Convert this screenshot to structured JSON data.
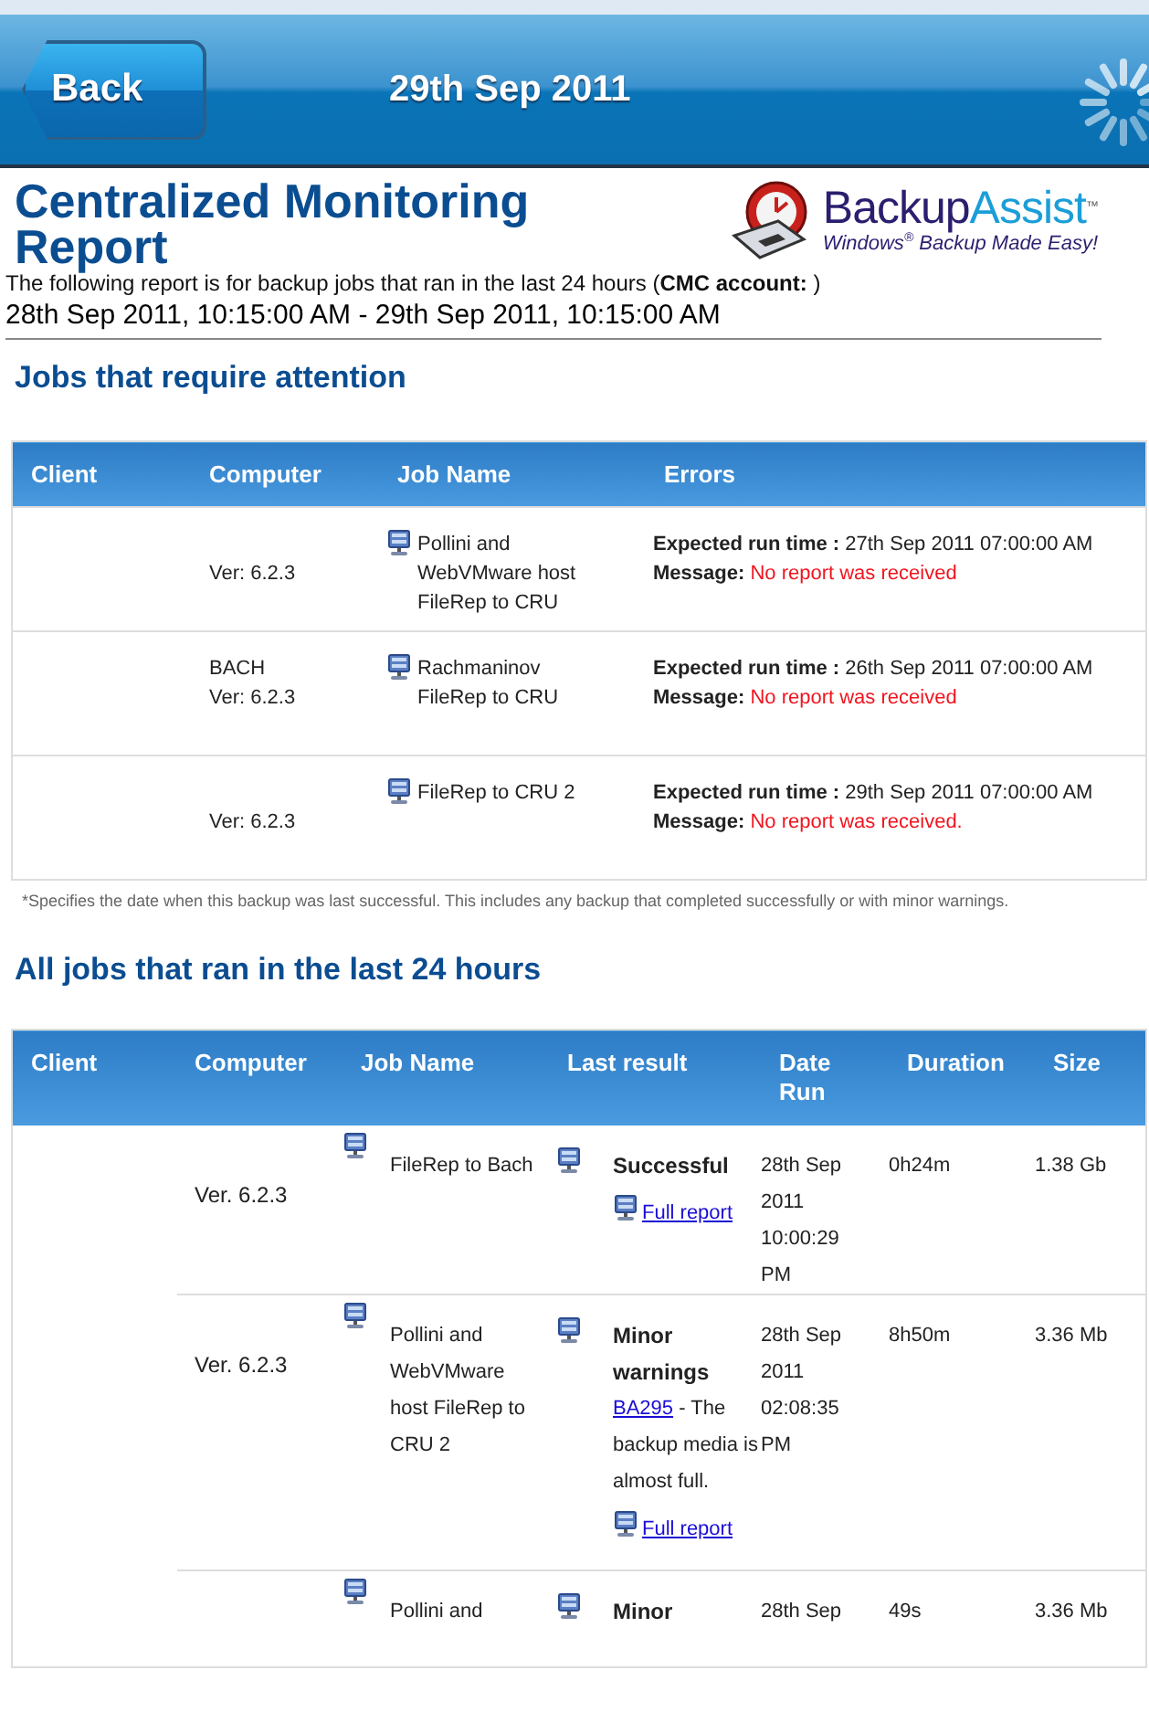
{
  "header": {
    "back": "Back",
    "title": "29th Sep 2011"
  },
  "report": {
    "title": "Centralized Monitoring Report",
    "logo_word_1": "Backup",
    "logo_word_2": "Assist",
    "logo_tm": "™",
    "logo_tagline": "Windows$^{®}$ Backup Made Easy!",
    "intro": "The following report is for backup jobs that ran in the last 24 hours (**CMC account:** )",
    "range": "28th Sep 2011, 10:15:00 AM - 29th Sep 2011, 10:15:00 AM"
  },
  "attention": {
    "heading": "Jobs that require attention",
    "columns": [
      "Client",
      "Computer",
      "Job Name",
      "Errors"
    ],
    "rows": [
      {
        "version": "Ver: 6.2.3",
        "job": "Pollini and WebVMware host FileRep to CRU",
        "expected_label": "Expected run time :",
        "expected": "27th Sep 2011 07:00:00 AM",
        "message_label": "Message:",
        "message": "No report was received"
      },
      {
        "computer": "BACH",
        "version": "Ver: 6.2.3",
        "job": "Rachmaninov FileRep to CRU",
        "expected_label": "Expected run time :",
        "expected": "26th Sep 2011 07:00:00 AM",
        "message_label": "Message:",
        "message": "No report was received"
      },
      {
        "version": "Ver: 6.2.3",
        "job": "FileRep to CRU 2",
        "expected_label": "Expected run time :",
        "expected": "29th Sep 2011 07:00:00 AM",
        "message_label": "Message:",
        "message": "No report was received."
      }
    ],
    "footnote": "*Specifies the date when this backup was last successful. This includes any backup that completed successfully or with minor warnings."
  },
  "all_jobs": {
    "heading": "All jobs that ran in the last 24 hours",
    "columns": [
      "Client",
      "Computer",
      "Job Name",
      "Last result",
      "Date Run",
      "Duration",
      "Size"
    ],
    "rows": [
      {
        "version": "Ver. 6.2.3",
        "job": "FileRep to Bach",
        "result": "Successful",
        "report_link": "Full report",
        "date": "28th Sep 2011 10:00:29 PM",
        "duration": "0h24m",
        "size": "1.38 Gb"
      },
      {
        "version": "Ver. 6.2.3",
        "job": "Pollini and WebVMware host FileRep to CRU 2",
        "result": "Minor warnings",
        "code_link": "BA295",
        "detail": " - The backup media is almost full.",
        "report_link": "Full report",
        "date": "28th Sep 2011 02:08:35 PM",
        "duration": "8h50m",
        "size": "3.36 Mb"
      },
      {
        "job": "Pollini and",
        "result": "Minor",
        "date": "28th Sep",
        "duration": "49s",
        "size": "3.36 Mb"
      }
    ]
  }
}
